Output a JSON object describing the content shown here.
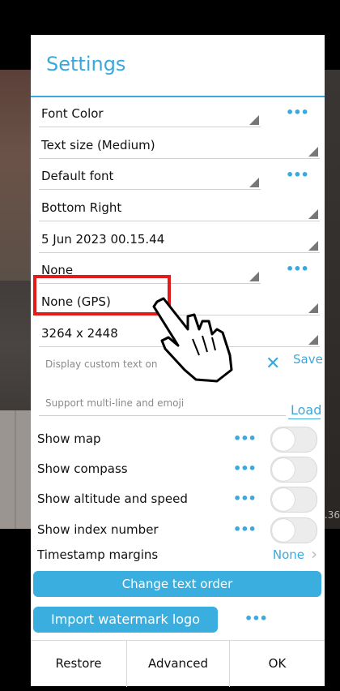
{
  "background": {
    "scale_text": ".36"
  },
  "dialog": {
    "title": "Settings",
    "selects": [
      {
        "label": "Font Color",
        "has_more": true
      },
      {
        "label": "Text size (Medium)",
        "has_more": false
      },
      {
        "label": "Default font",
        "has_more": true
      },
      {
        "label": "Bottom Right",
        "has_more": false
      },
      {
        "label": "5 Jun 2023 00.15.44",
        "has_more": false
      },
      {
        "label": "None",
        "has_more": true
      },
      {
        "label": "None (GPS)",
        "has_more": false
      },
      {
        "label": "3264 x 2448",
        "has_more": false
      }
    ],
    "more_icon": "•••",
    "custom_text": {
      "placeholder": "Display custom text on",
      "clear_icon": "✕",
      "save_label": "Save"
    },
    "multiline": {
      "placeholder": "Support multi-line and emoji",
      "load_label": "Load"
    },
    "toggles": [
      {
        "label": "Show map",
        "on": false
      },
      {
        "label": "Show compass",
        "on": false
      },
      {
        "label": "Show altitude and speed",
        "on": false
      },
      {
        "label": "Show index number",
        "on": false
      }
    ],
    "timestamp_margins": {
      "label": "Timestamp margins",
      "value": "None",
      "chevron": "›"
    },
    "change_text_order": "Change text order",
    "import_watermark_logo": "Import watermark logo",
    "footer": {
      "restore": "Restore",
      "advanced": "Advanced",
      "ok": "OK"
    }
  },
  "colors": {
    "accent": "#3aa9dd",
    "highlight": "#e31b1b"
  }
}
